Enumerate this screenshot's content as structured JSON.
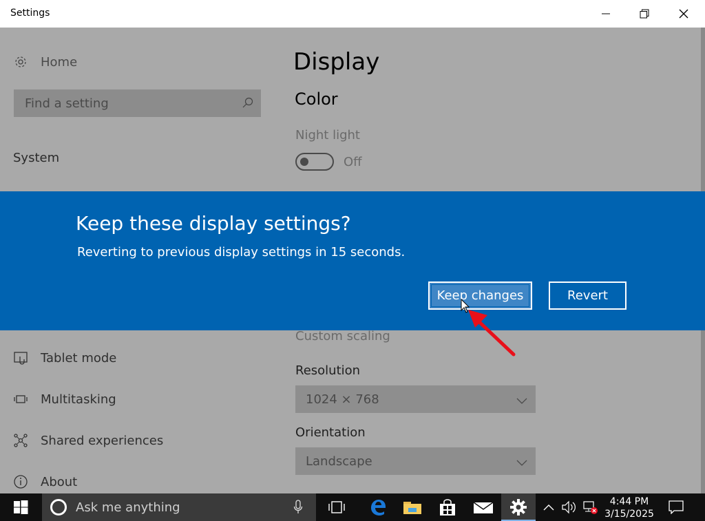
{
  "window": {
    "title": "Settings"
  },
  "sidebar": {
    "home_label": "Home",
    "search_placeholder": "Find a setting",
    "section_title": "System",
    "items": [
      {
        "label": "Tablet mode",
        "icon": "tablet-mode-icon"
      },
      {
        "label": "Multitasking",
        "icon": "multitasking-icon"
      },
      {
        "label": "Shared experiences",
        "icon": "shared-experiences-icon"
      },
      {
        "label": "About",
        "icon": "info-icon"
      }
    ]
  },
  "main": {
    "page_title": "Display",
    "color_heading": "Color",
    "night_light_label": "Night light",
    "night_light_state": "Off",
    "custom_scaling_label": "Custom scaling",
    "resolution_label": "Resolution",
    "resolution_value": "1024 × 768",
    "orientation_label": "Orientation",
    "orientation_value": "Landscape"
  },
  "dialog": {
    "title": "Keep these display settings?",
    "message": "Reverting to previous display settings in 15 seconds.",
    "keep_label": "Keep changes",
    "revert_label": "Revert",
    "accent_color": "#0063b1"
  },
  "taskbar": {
    "search_text": "Ask me anything",
    "time": "4:44 PM",
    "date": "3/15/2025"
  }
}
